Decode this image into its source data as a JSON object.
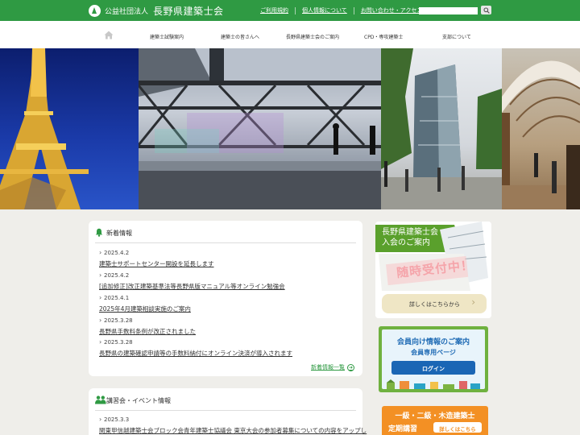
{
  "header": {
    "org_prefix": "公益社団法人",
    "org_name": "長野県建築士会",
    "links": [
      "ご利用規約",
      "個人情報について",
      "お問い合わせ・アクセス"
    ],
    "search_value": ""
  },
  "nav": {
    "items": [
      "建築士試験案内",
      "建築士の皆さんへ",
      "長野県建築士会のご案内",
      "CPD・専攻建築士",
      "支部について"
    ]
  },
  "news": {
    "title": "新着情報",
    "items": [
      {
        "date": "2025.4.2",
        "text": "建築士サポートセンター開設を延長します"
      },
      {
        "date": "2025.4.2",
        "text": "[追加修正]改正建築基準法等長野県版マニュアル等オンライン勉強会"
      },
      {
        "date": "2025.4.1",
        "text": "2025年4月建築相談実施のご案内"
      },
      {
        "date": "2025.3.28",
        "text": "長野県手数料条例が改正されました"
      },
      {
        "date": "2025.3.28",
        "text": "長野県の建築確認申請等の手数料納付にオンライン決済が導入されます"
      }
    ],
    "more": "新着情報一覧"
  },
  "events": {
    "title": "講習会・イベント情報",
    "items": [
      {
        "date": "2025.3.3",
        "text": "関東甲信越建築士会ブロック会青年建築士協議会 東京大会の参加者募集についての内容をアップし"
      }
    ]
  },
  "banners": {
    "join": {
      "line1": "長野県建築士会",
      "line2": "入会のご案内",
      "stamp": "随時受付中！",
      "button": "詳しくはこちらから"
    },
    "member": {
      "line1": "会員向け情報のご案内",
      "line2": "会員専用ページ",
      "button": "ログイン"
    },
    "course": {
      "line1": "一級・二級・木造建築士",
      "line2": "定期講習",
      "button": "詳しくはこちら"
    }
  },
  "colors": {
    "brand_green": "#2f9a43",
    "orange": "#f39024"
  }
}
